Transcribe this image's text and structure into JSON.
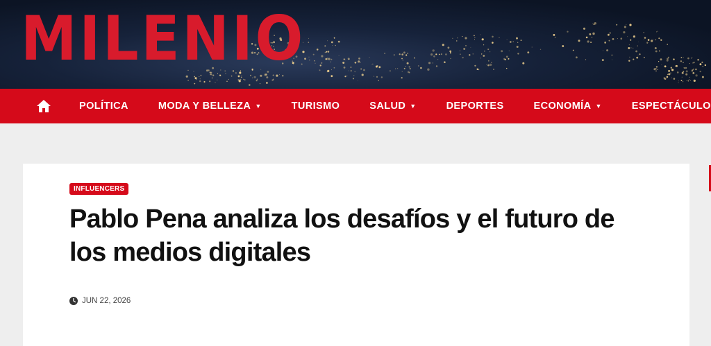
{
  "site": {
    "logo": "MILENIO"
  },
  "nav": {
    "home_icon": "home-icon",
    "items": [
      {
        "label": "POLÍTICA",
        "has_dropdown": false
      },
      {
        "label": "MODA Y BELLEZA",
        "has_dropdown": true
      },
      {
        "label": "TURISMO",
        "has_dropdown": false
      },
      {
        "label": "SALUD",
        "has_dropdown": true
      },
      {
        "label": "DEPORTES",
        "has_dropdown": false
      },
      {
        "label": "ECONOMÍA",
        "has_dropdown": true
      },
      {
        "label": "ESPECTÁCULOS",
        "has_dropdown": false
      }
    ],
    "caret": "▼"
  },
  "article": {
    "category": "INFLUENCERS",
    "title": "Pablo Pena analiza los desafíos y el futuro de los medios digitales",
    "date": "JUN 22, 2026",
    "date_icon": "clock-icon"
  },
  "colors": {
    "brand_red": "#d50a1a",
    "logo_red": "#d81b2c",
    "page_bg": "#eeeeee"
  }
}
